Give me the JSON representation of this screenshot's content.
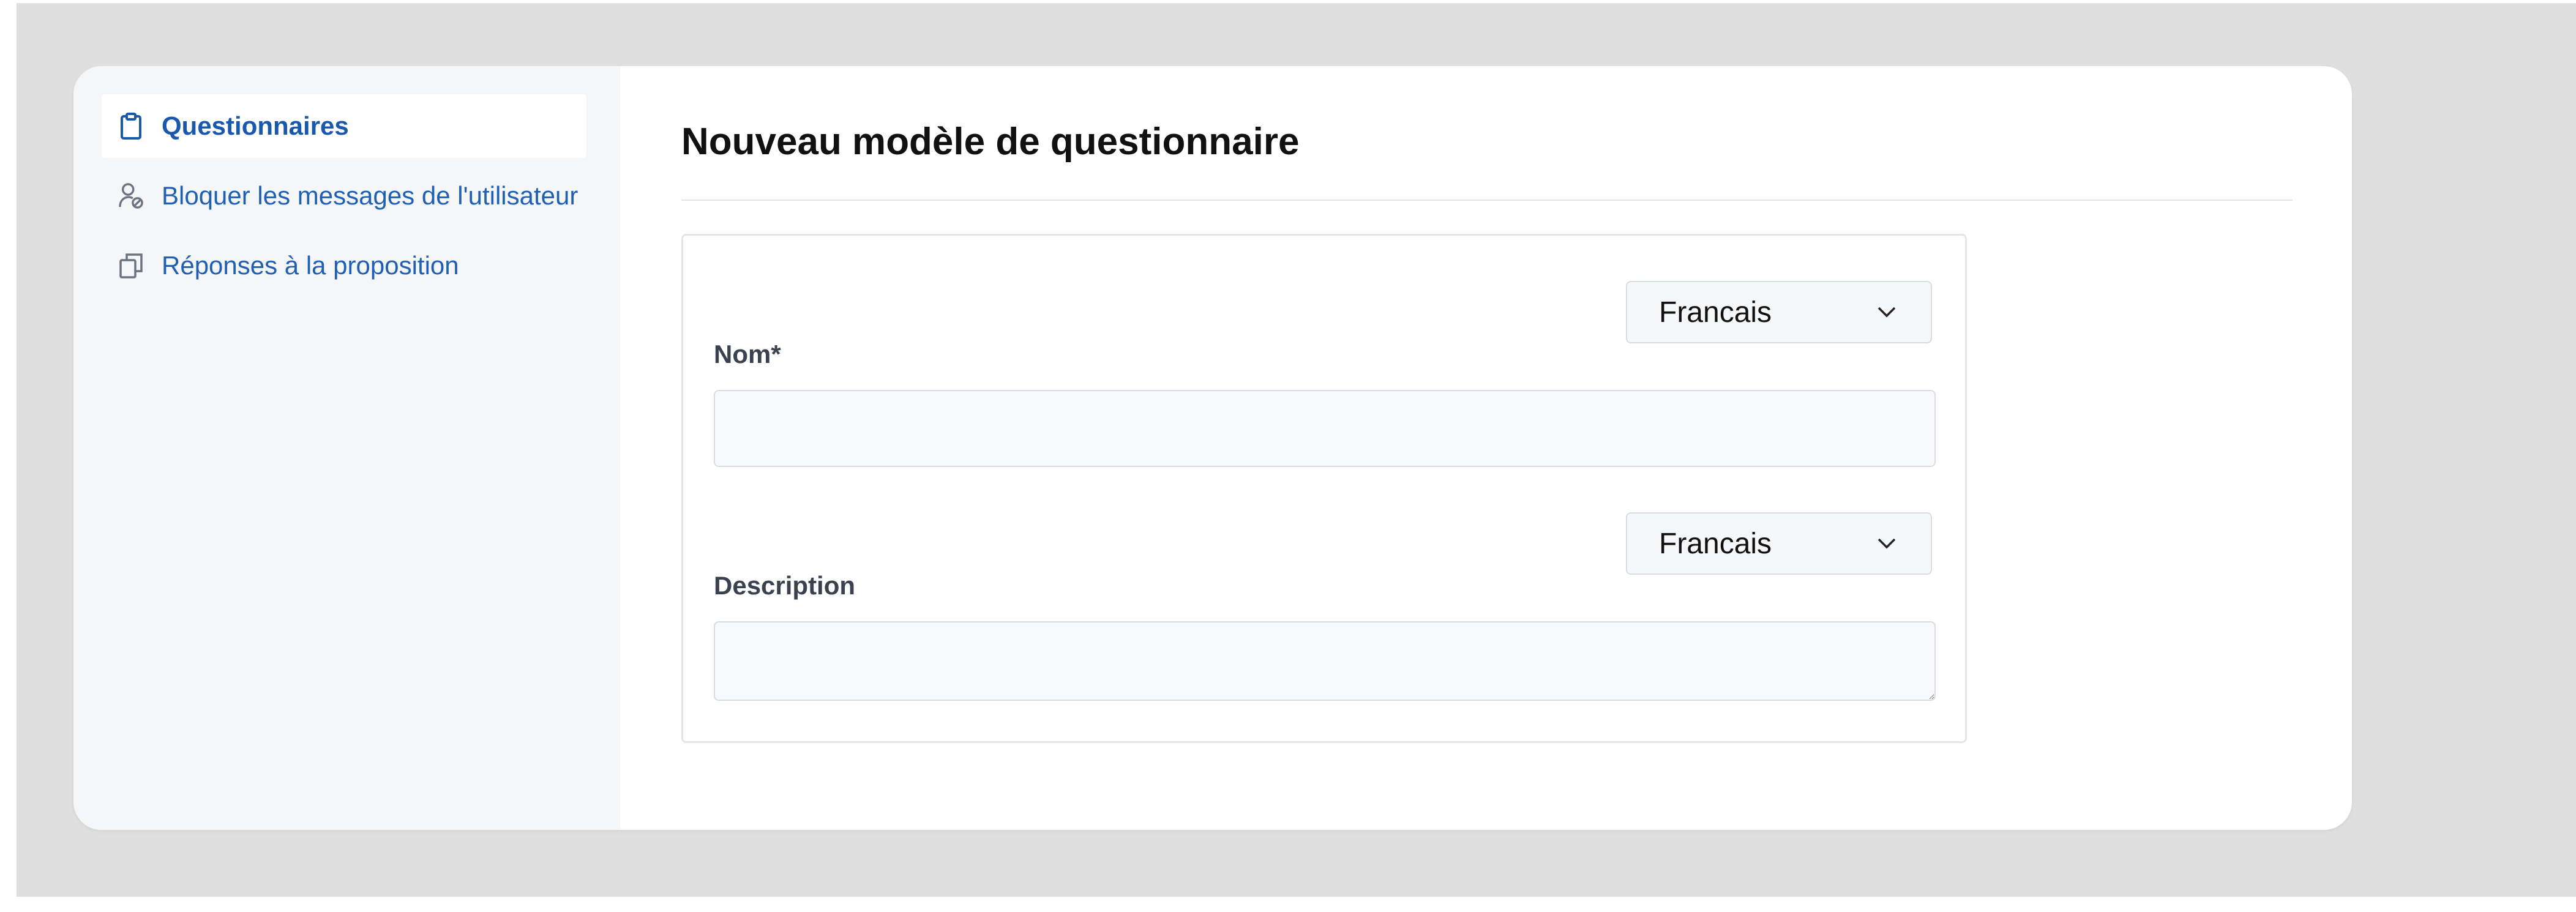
{
  "sidebar": {
    "items": [
      {
        "label": "Questionnaires",
        "icon": "clipboard-icon",
        "active": true
      },
      {
        "label": "Bloquer les messages de l'utilisateur",
        "icon": "user-block-icon",
        "active": false
      },
      {
        "label": "Réponses à la proposition",
        "icon": "copy-icon",
        "active": false
      }
    ]
  },
  "main": {
    "title": "Nouveau modèle de questionnaire",
    "form": {
      "name_field": {
        "label": "Nom*",
        "value": "",
        "language": "Francais"
      },
      "description_field": {
        "label": "Description",
        "value": "",
        "language": "Francais"
      }
    }
  },
  "colors": {
    "link": "#1f5fb4",
    "sidebar_bg": "#f5f6f8",
    "backdrop": "#dfdfdf"
  }
}
